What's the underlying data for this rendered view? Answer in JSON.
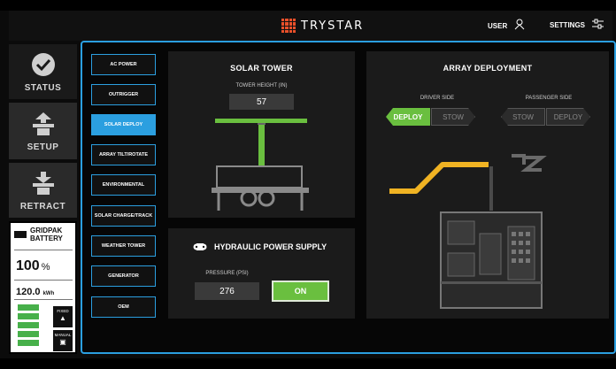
{
  "header": {
    "brand": "TRYSTAR",
    "user_label": "USER",
    "settings_label": "SETTINGS",
    "user_icon": "person-outline-icon",
    "settings_icon": "sliders-icon"
  },
  "nav": {
    "status": {
      "label": "STATUS",
      "icon": "checkmark-circle-icon"
    },
    "setup": {
      "label": "SETUP",
      "icon": "tower-setup-icon"
    },
    "retract": {
      "label": "RETRACT",
      "icon": "tower-retract-icon"
    }
  },
  "battery": {
    "title_line1": "GRIDPAK",
    "title_line2": "BATTERY",
    "percent": "100",
    "percent_unit": "%",
    "energy": "120.0",
    "energy_unit": "kWh",
    "level_bars_filled": 5,
    "fixed_label": "FIXED",
    "manual_label": "MANUAL"
  },
  "menu": {
    "items": [
      {
        "label": "AC POWER"
      },
      {
        "label": "OUTRIGGER"
      },
      {
        "label": "SOLAR DEPLOY",
        "active": true
      },
      {
        "label": "ARRAY TILT/ROTATE"
      },
      {
        "label": "ENVIRONMENTAL"
      },
      {
        "label": "SOLAR CHARGE/TRACK"
      },
      {
        "label": "WEATHER TOWER"
      },
      {
        "label": "GENERATOR"
      },
      {
        "label": "OEM"
      }
    ]
  },
  "solar_tower": {
    "title": "SOLAR TOWER",
    "height_label": "TOWER HEIGHT (IN)",
    "height_value": "57"
  },
  "hydraulic": {
    "title": "HYDRAULIC POWER SUPPLY",
    "pressure_label": "PRESSURE (PSI)",
    "pressure_value": "276",
    "power_button": "ON"
  },
  "array": {
    "title": "ARRAY DEPLOYMENT",
    "driver_label": "DRIVER SIDE",
    "passenger_label": "PASSENGER SIDE",
    "deploy_label": "DEPLOY",
    "stow_label": "STOW",
    "driver_state": "DEPLOY"
  },
  "colors": {
    "accent_blue": "#2b9fe0",
    "active_green": "#6abf3f",
    "array_yellow": "#f0b323",
    "brand_orange": "#e8502a"
  }
}
